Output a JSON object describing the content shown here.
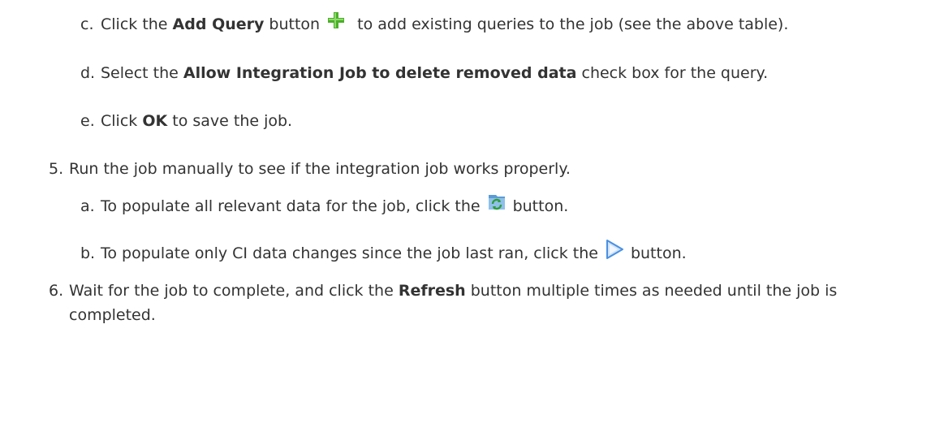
{
  "steps": {
    "c": {
      "marker": "c.",
      "pre": "Click the ",
      "bold": "Add Query",
      "mid": " button",
      "icon": "add-plus-icon",
      "post": " to add existing queries to the job (see the above table)."
    },
    "d": {
      "marker": "d.",
      "pre": "Select the ",
      "bold": "Allow Integration Job to delete removed data",
      "post": " check box for the query."
    },
    "e": {
      "marker": "e.",
      "pre": "Click ",
      "bold": "OK",
      "post": " to save the job."
    },
    "s5": {
      "marker": "5.",
      "text": "Run the job manually to see if the integration job works properly."
    },
    "a": {
      "marker": "a.",
      "pre": "To populate all relevant data for the job, click the",
      "icon": "full-sync-icon",
      "post": "button."
    },
    "b": {
      "marker": "b.",
      "pre": "To populate only CI data changes since the job last ran, click the",
      "icon": "delta-sync-play-icon",
      "post": "button."
    },
    "s6": {
      "marker": "6.",
      "pre": "Wait for the job to complete, and click the ",
      "bold": "Refresh",
      "post": " button multiple times as needed until the job is",
      "cont": "completed."
    }
  },
  "colors": {
    "text": "#333333",
    "plus_green": "#4caf28",
    "sync_blue": "#5b9bd5",
    "play_blue": "#4a90e2"
  }
}
